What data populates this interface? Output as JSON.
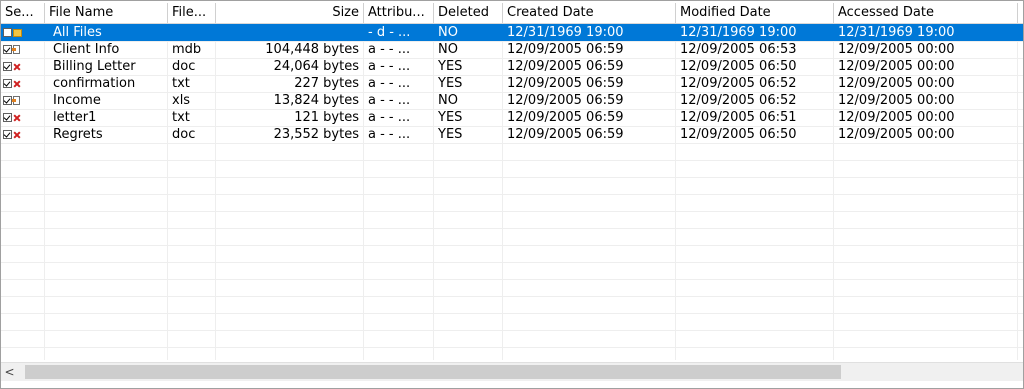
{
  "columns": [
    {
      "label": "Se...",
      "w": 44
    },
    {
      "label": "File Name",
      "w": 123
    },
    {
      "label": "File...",
      "w": 48
    },
    {
      "label": "Size",
      "w": 148,
      "align": "right"
    },
    {
      "label": "Attribu...",
      "w": 70
    },
    {
      "label": "Deleted",
      "w": 69
    },
    {
      "label": "Created Date",
      "w": 173
    },
    {
      "label": "Modified Date",
      "w": 158
    },
    {
      "label": "Accessed Date",
      "w": 184
    }
  ],
  "rows": [
    {
      "checked": false,
      "icon": "folder",
      "name": "All Files",
      "type": "",
      "size": "",
      "attr": "- d - ...",
      "deleted": "NO",
      "created": "12/31/1969 19:00",
      "modified": "12/31/1969 19:00",
      "accessed": "12/31/1969 19:00",
      "selected": true
    },
    {
      "checked": true,
      "icon": "file",
      "name": "Client Info",
      "type": "mdb",
      "size": "104,448 bytes",
      "attr": "a - - ...",
      "deleted": "NO",
      "created": "12/09/2005 06:59",
      "modified": "12/09/2005 06:53",
      "accessed": "12/09/2005 00:00"
    },
    {
      "checked": true,
      "icon": "deleted",
      "name": "Billing Letter",
      "type": "doc",
      "size": "24,064 bytes",
      "attr": "a - - ...",
      "deleted": "YES",
      "created": "12/09/2005 06:59",
      "modified": "12/09/2005 06:50",
      "accessed": "12/09/2005 00:00"
    },
    {
      "checked": true,
      "icon": "deleted",
      "name": "confirmation",
      "type": "txt",
      "size": "227 bytes",
      "attr": "a - - ...",
      "deleted": "YES",
      "created": "12/09/2005 06:59",
      "modified": "12/09/2005 06:52",
      "accessed": "12/09/2005 00:00"
    },
    {
      "checked": true,
      "icon": "file",
      "name": "Income",
      "type": "xls",
      "size": "13,824 bytes",
      "attr": "a - - ...",
      "deleted": "NO",
      "created": "12/09/2005 06:59",
      "modified": "12/09/2005 06:52",
      "accessed": "12/09/2005 00:00"
    },
    {
      "checked": true,
      "icon": "deleted",
      "name": "letter1",
      "type": "txt",
      "size": "121 bytes",
      "attr": "a - - ...",
      "deleted": "YES",
      "created": "12/09/2005 06:59",
      "modified": "12/09/2005 06:51",
      "accessed": "12/09/2005 00:00"
    },
    {
      "checked": true,
      "icon": "deleted",
      "name": "Regrets",
      "type": "doc",
      "size": "23,552 bytes",
      "attr": "a - - ...",
      "deleted": "YES",
      "created": "12/09/2005 06:59",
      "modified": "12/09/2005 06:50",
      "accessed": "12/09/2005 00:00"
    }
  ],
  "scrollbar": {
    "left_arrow": "<"
  }
}
